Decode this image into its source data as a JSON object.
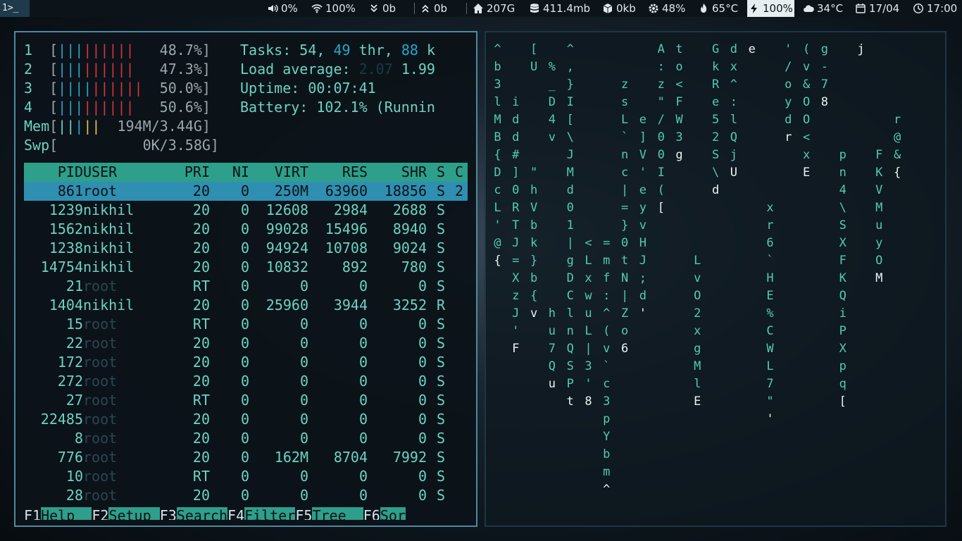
{
  "topbar": {
    "workspace": "1>_",
    "volume": "0%",
    "wifi": "100%",
    "down": "0b",
    "up": "0b",
    "home_disk": "207G",
    "memory": "411.4mb",
    "swap": "0kb",
    "cpu": "48%",
    "temp": "65°C",
    "battery": "100%",
    "weather": "34°C",
    "date": "17/04",
    "time": "17:00",
    "icons": [
      "volume-icon",
      "wifi-icon",
      "download-icon",
      "upload-icon",
      "home-icon",
      "database-icon",
      "cube-icon",
      "cpu-gear-icon",
      "flame-icon",
      "battery-bolt-icon",
      "cloud-icon",
      "calendar-icon",
      "clock-icon"
    ]
  },
  "htop": {
    "cpus": [
      {
        "id": "1",
        "blue": "|||",
        "red": "||||||",
        "pct": "48.7%"
      },
      {
        "id": "2",
        "blue": "|||",
        "red": "||||||",
        "pct": "47.3%"
      },
      {
        "id": "3",
        "blue": "||||",
        "red": "||||||",
        "pct": "50.0%"
      },
      {
        "id": "4",
        "blue": "|||",
        "red": "||||||",
        "pct": "50.6%"
      }
    ],
    "mem": {
      "label": "Mem",
      "value": "194M/3.44G"
    },
    "swp": {
      "label": "Swp",
      "value": "0K/3.58G"
    },
    "info": {
      "tasks_label": "Tasks:",
      "tasks": "54,",
      "threads": "49",
      "thr": "thr,",
      "running": "88",
      "k": "k",
      "load_label": "Load average:",
      "load1": "2.07",
      "load2": "1.99",
      "uptime_label": "Uptime:",
      "uptime": "00:07:41",
      "battery_label": "Battery:",
      "battery": "102.1% (Runnin"
    },
    "columns": [
      "PID",
      "USER",
      "PRI",
      "NI",
      "VIRT",
      "RES",
      "SHR",
      "S",
      "C"
    ],
    "rows": [
      {
        "pid": "861",
        "user": "root",
        "pri": "20",
        "ni": "0",
        "virt": "250M",
        "res": "63960",
        "shr": "18856",
        "s": "S",
        "c": "2",
        "selected": true
      },
      {
        "pid": "1239",
        "user": "nikhil",
        "pri": "20",
        "ni": "0",
        "virt": "12608",
        "res": "2984",
        "shr": "2688",
        "s": "S"
      },
      {
        "pid": "1562",
        "user": "nikhil",
        "pri": "20",
        "ni": "0",
        "virt": "99028",
        "res": "15496",
        "shr": "8940",
        "s": "S"
      },
      {
        "pid": "1238",
        "user": "nikhil",
        "pri": "20",
        "ni": "0",
        "virt": "94924",
        "res": "10708",
        "shr": "9024",
        "s": "S"
      },
      {
        "pid": "14754",
        "user": "nikhil",
        "pri": "20",
        "ni": "0",
        "virt": "10832",
        "res": "892",
        "shr": "780",
        "s": "S"
      },
      {
        "pid": "21",
        "user": "root",
        "pri": "RT",
        "ni": "0",
        "virt": "0",
        "res": "0",
        "shr": "0",
        "s": "S",
        "dim": true
      },
      {
        "pid": "1404",
        "user": "nikhil",
        "pri": "20",
        "ni": "0",
        "virt": "25960",
        "res": "3944",
        "shr": "3252",
        "s": "R"
      },
      {
        "pid": "15",
        "user": "root",
        "pri": "RT",
        "ni": "0",
        "virt": "0",
        "res": "0",
        "shr": "0",
        "s": "S",
        "dim": true
      },
      {
        "pid": "22",
        "user": "root",
        "pri": "20",
        "ni": "0",
        "virt": "0",
        "res": "0",
        "shr": "0",
        "s": "S",
        "dim": true
      },
      {
        "pid": "172",
        "user": "root",
        "pri": "20",
        "ni": "0",
        "virt": "0",
        "res": "0",
        "shr": "0",
        "s": "S",
        "dim": true
      },
      {
        "pid": "272",
        "user": "root",
        "pri": "20",
        "ni": "0",
        "virt": "0",
        "res": "0",
        "shr": "0",
        "s": "S",
        "dim": true
      },
      {
        "pid": "27",
        "user": "root",
        "pri": "RT",
        "ni": "0",
        "virt": "0",
        "res": "0",
        "shr": "0",
        "s": "S",
        "dim": true
      },
      {
        "pid": "22485",
        "user": "root",
        "pri": "20",
        "ni": "0",
        "virt": "0",
        "res": "0",
        "shr": "0",
        "s": "S",
        "dim": true
      },
      {
        "pid": "8",
        "user": "root",
        "pri": "20",
        "ni": "0",
        "virt": "0",
        "res": "0",
        "shr": "0",
        "s": "S",
        "dim": true
      },
      {
        "pid": "776",
        "user": "root",
        "pri": "20",
        "ni": "0",
        "virt": "162M",
        "res": "8704",
        "shr": "7992",
        "s": "S",
        "dim": true
      },
      {
        "pid": "10",
        "user": "root",
        "pri": "RT",
        "ni": "0",
        "virt": "0",
        "res": "0",
        "shr": "0",
        "s": "S",
        "dim": true
      },
      {
        "pid": "28",
        "user": "root",
        "pri": "20",
        "ni": "0",
        "virt": "0",
        "res": "0",
        "shr": "0",
        "s": "S",
        "dim": true
      }
    ],
    "footer": [
      {
        "key": "F1",
        "label": "Help  "
      },
      {
        "key": "F2",
        "label": "Setup "
      },
      {
        "key": "F3",
        "label": "Search"
      },
      {
        "key": "F4",
        "label": "Filter"
      },
      {
        "key": "F5",
        "label": "Tree  "
      },
      {
        "key": "F6",
        "label": "Sor"
      }
    ]
  },
  "matrix": {
    "columns": [
      {
        "row": 0,
        "chars": "^b3lMB{DcL'@{"
      },
      {
        "row": 3,
        "chars": "idd#]0RTJ=XzJ'F"
      },
      {
        "row": 0,
        "chars": "[U     \"hVbk}b{v"
      },
      {
        "row": 0,
        "chars": " %_D4v         hu7Qu"
      },
      {
        "row": 0,
        "chars": "^,}I[\\JMd01|gDClnQSPt"
      },
      {
        "row": 11,
        "chars": "<LxwuL|3'8"
      },
      {
        "row": 11,
        "chars": "=mf:^(v`c3pYbm^"
      },
      {
        "row": 2,
        "chars": "zsL`nc|=}0tN|Zo6"
      },
      {
        "row": 4,
        "chars": "e]V'eyvHJ;d'"
      },
      {
        "row": 0,
        "chars": "A:z\"/00I(["
      },
      {
        "row": 0,
        "chars": "to<FW3g"
      },
      {
        "row": 12,
        "chars": "LvO2xgMlE"
      },
      {
        "row": 0,
        "chars": "GkRe52S\\d"
      },
      {
        "row": 0,
        "chars": "dx^:lQjU"
      },
      {
        "row": 0,
        "chars": "e"
      },
      {
        "row": 9,
        "chars": "xr6`HE%CWL7\"'"
      },
      {
        "row": 0,
        "chars": "'/oydr"
      },
      {
        "row": 0,
        "chars": "(v&OO<xE"
      },
      {
        "row": 0,
        "chars": "g-78"
      },
      {
        "row": 6,
        "chars": "pn4\\SXFKQiPXpq["
      },
      {
        "row": 0,
        "chars": "j"
      },
      {
        "row": 6,
        "chars": "FKVMuyOM"
      },
      {
        "row": 4,
        "chars": "r@&{"
      }
    ]
  }
}
